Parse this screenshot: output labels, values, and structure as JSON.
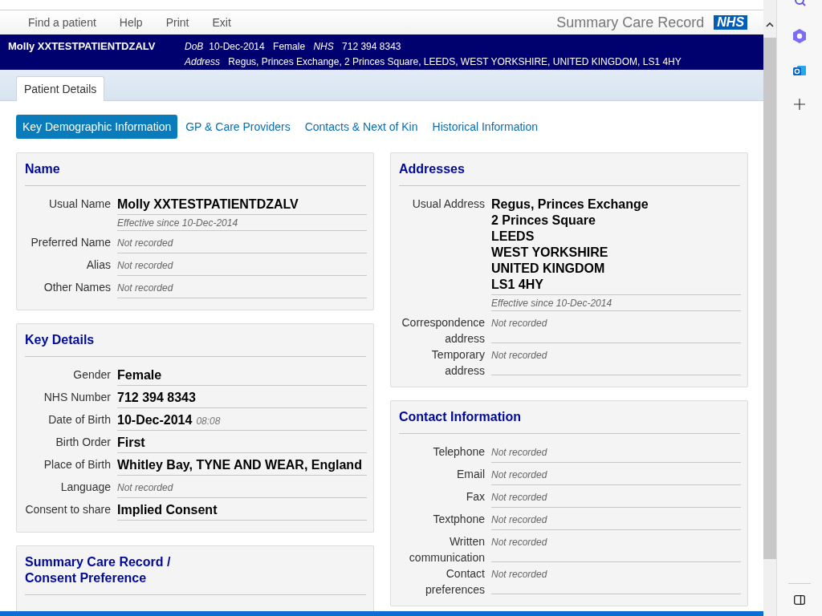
{
  "menu": [
    "Find a patient",
    "Help",
    "Print",
    "Exit"
  ],
  "brand": {
    "title": "Summary Care Record",
    "logo": "NHS"
  },
  "banner": {
    "name": "Molly XXTESTPATIENTDZALV",
    "dob_label": "DoB",
    "dob": "10-Dec-2014",
    "gender": "Female",
    "nhs_label": "NHS",
    "nhs": "712 394 8343",
    "address_label": "Address",
    "address": "Regus, Princes Exchange, 2 Princes Square, LEEDS, WEST YORKSHIRE, UNITED KINGDOM, LS1 4HY"
  },
  "tabs": [
    {
      "label": "Patient Details",
      "selected": true
    }
  ],
  "subtabs": [
    {
      "label": "Key Demographic Information",
      "selected": true
    },
    {
      "label": "GP & Care Providers",
      "selected": false
    },
    {
      "label": "Contacts & Next of Kin",
      "selected": false
    },
    {
      "label": "Historical Information",
      "selected": false
    }
  ],
  "columns": [
    [
      {
        "title": "Name",
        "fields": [
          {
            "label": "Usual Name",
            "kind": "value",
            "value": [
              "Molly XXTESTPATIENTDZALV"
            ],
            "effective": "Effective since 10-Dec-2014"
          },
          {
            "label": "Preferred Name",
            "kind": "empty",
            "value": [
              "Not recorded"
            ]
          },
          {
            "label": "Alias",
            "kind": "empty",
            "value": [
              "Not recorded"
            ]
          },
          {
            "label": "Other Names",
            "kind": "empty",
            "value": [
              "Not recorded"
            ]
          }
        ]
      },
      {
        "title": "Key Details",
        "fields": [
          {
            "label": "Gender",
            "kind": "value",
            "value": [
              "Female"
            ]
          },
          {
            "label": "NHS Number",
            "kind": "value",
            "value": [
              "712 394 8343"
            ]
          },
          {
            "label": "Date of Birth",
            "kind": "value",
            "value": [
              "10-Dec-2014"
            ],
            "time": "08:08"
          },
          {
            "label": "Birth Order",
            "kind": "value",
            "value": [
              "First"
            ]
          },
          {
            "label": "Place of Birth",
            "kind": "value",
            "value": [
              "Whitley Bay, TYNE AND WEAR, England"
            ]
          },
          {
            "label": "Language",
            "kind": "empty",
            "value": [
              "Not recorded"
            ]
          },
          {
            "label": "Consent to share",
            "kind": "value",
            "value": [
              "Implied Consent"
            ]
          }
        ]
      },
      {
        "title": "Summary Care Record / Consent Preference"
      }
    ],
    [
      {
        "title": "Addresses",
        "fields": [
          {
            "label": "Usual Address",
            "kind": "value",
            "value": [
              "Regus, Princes Exchange",
              "2 Princes Square",
              "LEEDS",
              "WEST YORKSHIRE",
              "UNITED KINGDOM",
              "LS1 4HY"
            ],
            "effective": "Effective since 10-Dec-2014"
          },
          {
            "label": "Correspondence address",
            "kind": "empty",
            "value": [
              "Not recorded"
            ]
          },
          {
            "label": "Temporary address",
            "kind": "empty",
            "value": [
              "Not recorded"
            ]
          }
        ]
      },
      {
        "title": "Contact Information",
        "fields": [
          {
            "label": "Telephone",
            "kind": "empty",
            "value": [
              "Not recorded"
            ]
          },
          {
            "label": "Email",
            "kind": "empty",
            "value": [
              "Not recorded"
            ]
          },
          {
            "label": "Fax",
            "kind": "empty",
            "value": [
              "Not recorded"
            ]
          },
          {
            "label": "Textphone",
            "kind": "empty",
            "value": [
              "Not recorded"
            ]
          },
          {
            "label": "Written communication",
            "kind": "empty",
            "value": [
              "Not recorded"
            ]
          },
          {
            "label": "Contact preferences",
            "kind": "empty",
            "value": [
              "Not recorded"
            ]
          }
        ]
      }
    ]
  ]
}
